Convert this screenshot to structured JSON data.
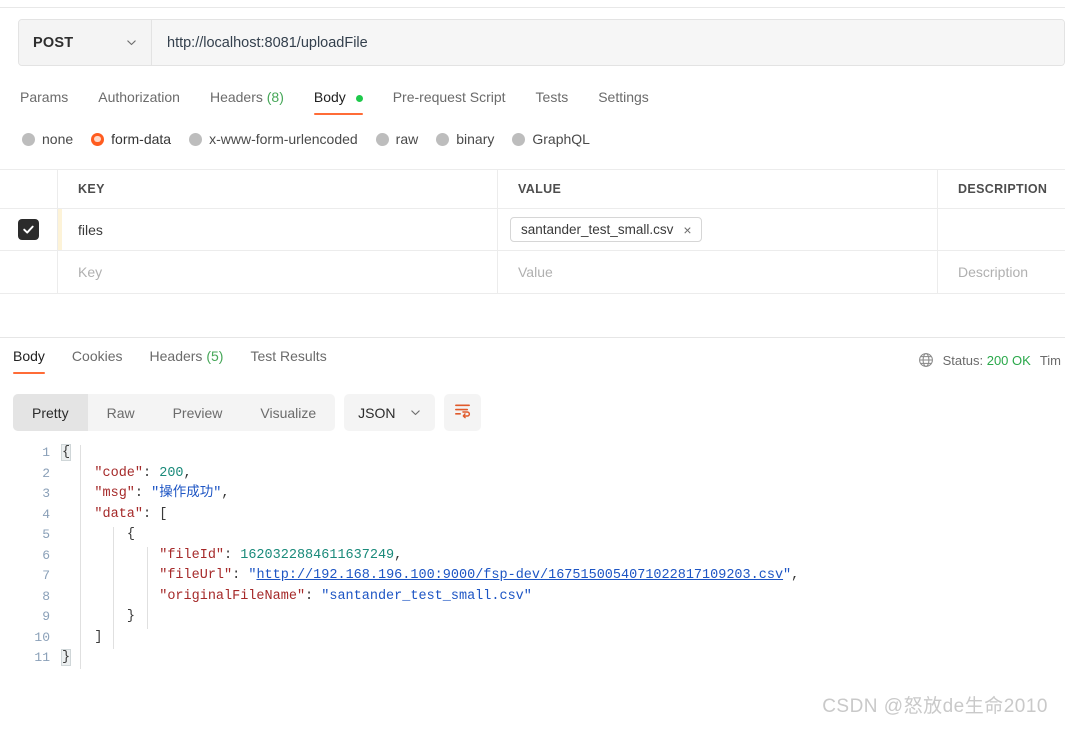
{
  "request": {
    "method": "POST",
    "url": "http://localhost:8081/uploadFile",
    "tabs": [
      {
        "label": "Params",
        "active": false
      },
      {
        "label": "Authorization",
        "active": false
      },
      {
        "label": "Headers",
        "count": "(8)",
        "active": false
      },
      {
        "label": "Body",
        "active": true,
        "dot": true
      },
      {
        "label": "Pre-request Script",
        "active": false
      },
      {
        "label": "Tests",
        "active": false
      },
      {
        "label": "Settings",
        "active": false
      }
    ],
    "body_types": [
      {
        "label": "none",
        "selected": false
      },
      {
        "label": "form-data",
        "selected": true
      },
      {
        "label": "x-www-form-urlencoded",
        "selected": false
      },
      {
        "label": "raw",
        "selected": false
      },
      {
        "label": "binary",
        "selected": false
      },
      {
        "label": "GraphQL",
        "selected": false
      }
    ],
    "table": {
      "headers": {
        "key": "KEY",
        "value": "VALUE",
        "description": "DESCRIPTION"
      },
      "rows": [
        {
          "checked": true,
          "key": "files",
          "value_chip": "santander_test_small.csv",
          "chip_close": "×",
          "description": ""
        }
      ],
      "placeholders": {
        "key": "Key",
        "value": "Value",
        "description": "Description"
      }
    }
  },
  "response": {
    "tabs": [
      {
        "label": "Body",
        "active": true
      },
      {
        "label": "Cookies",
        "active": false
      },
      {
        "label": "Headers",
        "count": "(5)",
        "active": false
      },
      {
        "label": "Test Results",
        "active": false
      }
    ],
    "status_label": "Status:",
    "status_value": "200 OK",
    "time_label": "Tim",
    "viewer": {
      "segments": [
        {
          "label": "Pretty",
          "active": true
        },
        {
          "label": "Raw",
          "active": false
        },
        {
          "label": "Preview",
          "active": false
        },
        {
          "label": "Visualize",
          "active": false
        }
      ],
      "format": "JSON"
    },
    "code_lines": [
      {
        "n": "1",
        "tokens": [
          {
            "t": "{",
            "c": "brace-hl"
          }
        ]
      },
      {
        "n": "2",
        "tokens": [
          {
            "t": "    ",
            "c": "p"
          },
          {
            "t": "\"code\"",
            "c": "k"
          },
          {
            "t": ": ",
            "c": "p"
          },
          {
            "t": "200",
            "c": "n"
          },
          {
            "t": ",",
            "c": "p"
          }
        ]
      },
      {
        "n": "3",
        "tokens": [
          {
            "t": "    ",
            "c": "p"
          },
          {
            "t": "\"msg\"",
            "c": "k"
          },
          {
            "t": ": ",
            "c": "p"
          },
          {
            "t": "\"操作成功\"",
            "c": "s"
          },
          {
            "t": ",",
            "c": "p"
          }
        ]
      },
      {
        "n": "4",
        "tokens": [
          {
            "t": "    ",
            "c": "p"
          },
          {
            "t": "\"data\"",
            "c": "k"
          },
          {
            "t": ": ",
            "c": "p"
          },
          {
            "t": "[",
            "c": "brace"
          }
        ]
      },
      {
        "n": "5",
        "tokens": [
          {
            "t": "        ",
            "c": "p"
          },
          {
            "t": "{",
            "c": "brace"
          }
        ]
      },
      {
        "n": "6",
        "tokens": [
          {
            "t": "            ",
            "c": "p"
          },
          {
            "t": "\"fileId\"",
            "c": "k"
          },
          {
            "t": ": ",
            "c": "p"
          },
          {
            "t": "1620322884611637249",
            "c": "n"
          },
          {
            "t": ",",
            "c": "p"
          }
        ]
      },
      {
        "n": "7",
        "tokens": [
          {
            "t": "            ",
            "c": "p"
          },
          {
            "t": "\"fileUrl\"",
            "c": "k"
          },
          {
            "t": ": ",
            "c": "p"
          },
          {
            "t": "\"",
            "c": "s"
          },
          {
            "t": "http://192.168.196.100:9000/fsp-dev/1675150054071022817109203.csv",
            "c": "lnk"
          },
          {
            "t": "\"",
            "c": "s"
          },
          {
            "t": ",",
            "c": "p"
          }
        ]
      },
      {
        "n": "8",
        "tokens": [
          {
            "t": "            ",
            "c": "p"
          },
          {
            "t": "\"originalFileName\"",
            "c": "k"
          },
          {
            "t": ": ",
            "c": "p"
          },
          {
            "t": "\"santander_test_small.csv\"",
            "c": "s"
          }
        ]
      },
      {
        "n": "9",
        "tokens": [
          {
            "t": "        ",
            "c": "p"
          },
          {
            "t": "}",
            "c": "brace"
          }
        ]
      },
      {
        "n": "10",
        "tokens": [
          {
            "t": "    ",
            "c": "p"
          },
          {
            "t": "]",
            "c": "brace"
          }
        ]
      },
      {
        "n": "11",
        "tokens": [
          {
            "t": "}",
            "c": "brace-hl"
          }
        ]
      }
    ]
  },
  "watermark": "CSDN @怒放de生命2010",
  "colors": {
    "accent": "#ff6c37",
    "success": "#2aa84a",
    "json_string": "#1d55c4",
    "json_key": "#a52929",
    "json_number": "#1a8a7a"
  }
}
